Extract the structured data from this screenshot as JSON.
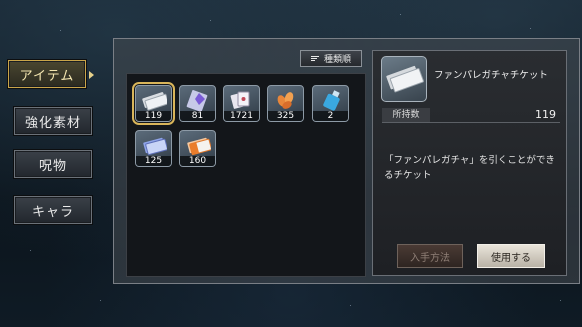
{
  "sidebar": {
    "tabs": [
      {
        "label": "アイテム",
        "active": true
      },
      {
        "label": "強化素材",
        "active": false
      },
      {
        "label": "呪物",
        "active": false
      },
      {
        "label": "キャラ",
        "active": false
      }
    ]
  },
  "toolbar": {
    "sort_label": "種類順",
    "sort_icon": "sort-icon"
  },
  "inventory": {
    "items": [
      {
        "qty": "119",
        "icon": "gacha-ticket-icon",
        "selected": true
      },
      {
        "qty": "81",
        "icon": "crystal-card-icon",
        "selected": false
      },
      {
        "qty": "1721",
        "icon": "cards-icon",
        "selected": false
      },
      {
        "qty": "325",
        "icon": "orange-petals-icon",
        "selected": false
      },
      {
        "qty": "2",
        "icon": "blue-bottle-icon",
        "selected": false
      },
      {
        "qty": "125",
        "icon": "blue-ticket-icon",
        "selected": false
      },
      {
        "qty": "160",
        "icon": "orange-ticket-icon",
        "selected": false
      }
    ]
  },
  "detail": {
    "name": "ファンパレガチャチケット",
    "owned_label": "所持数",
    "owned_value": "119",
    "description": "「ファンパレガチャ」を引くことができるチケット",
    "acquire_button": "入手方法",
    "use_button": "使用する"
  },
  "colors": {
    "accent_gold": "#d9b55a",
    "panel_bg": "#13161a"
  }
}
